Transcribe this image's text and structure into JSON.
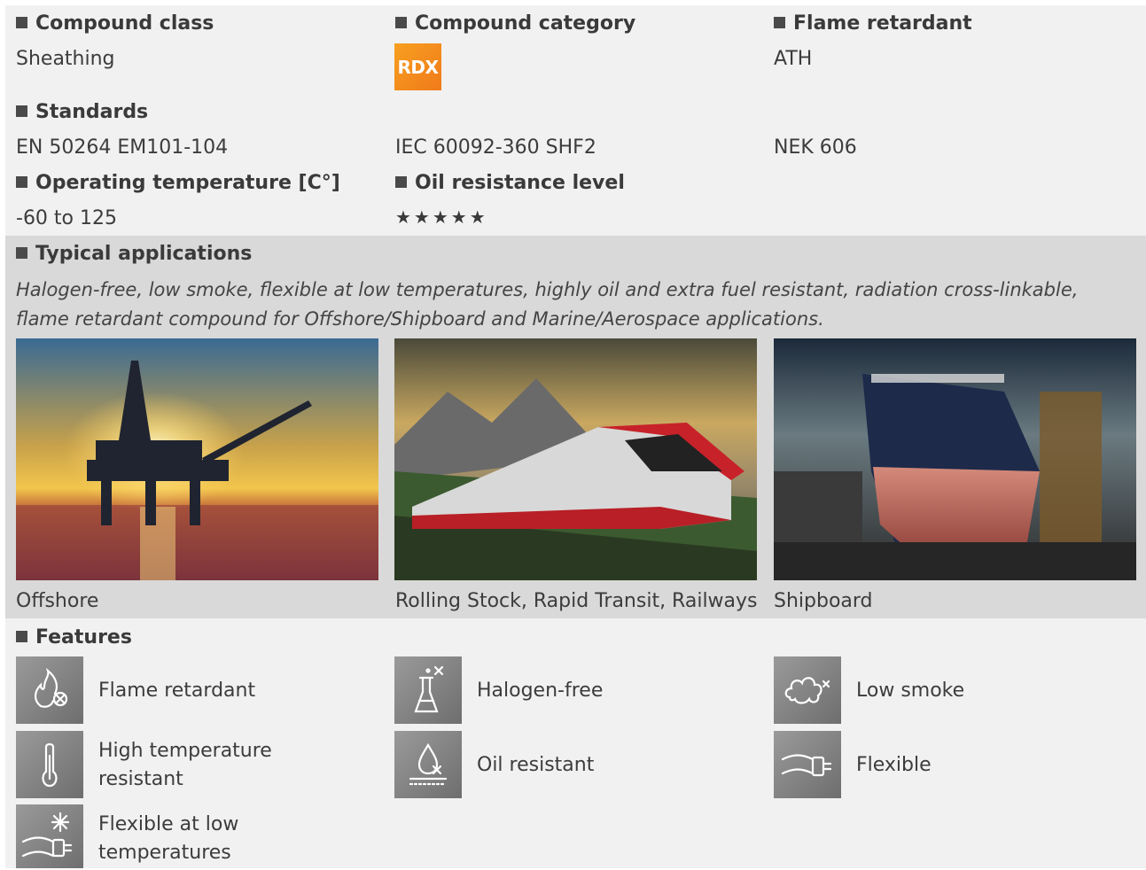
{
  "properties": {
    "compound_class": {
      "label": "Compound class",
      "value": "Sheathing"
    },
    "compound_category": {
      "label": "Compound category",
      "badge": "RDX",
      "badge_color": "#f39020"
    },
    "flame_retardant": {
      "label": "Flame retardant",
      "value": "ATH"
    },
    "standards": {
      "label": "Standards",
      "values": [
        "EN 50264 EM101-104",
        "IEC 60092-360 SHF2",
        "NEK 606"
      ]
    },
    "operating_temperature": {
      "label": "Operating temperature [C°]",
      "value": "-60 to 125"
    },
    "oil_resistance": {
      "label": "Oil resistance level",
      "stars": "★★★★★",
      "rating": 5
    }
  },
  "applications": {
    "label": "Typical applications",
    "description": "Halogen-free, low smoke, flexible at low temperatures, highly oil and extra fuel resistant, radiation cross-linkable, flame retardant compound for Offshore/Shipboard and Marine/Aerospace applications.",
    "items": [
      {
        "caption": "Offshore"
      },
      {
        "caption": "Rolling Stock, Rapid Transit, Railways"
      },
      {
        "caption": "Shipboard"
      }
    ]
  },
  "features": {
    "label": "Features",
    "items": [
      {
        "label": "Flame retardant",
        "icon": "flame-retardant-icon"
      },
      {
        "label": "Halogen-free",
        "icon": "halogen-free-icon"
      },
      {
        "label": "Low smoke",
        "icon": "low-smoke-icon"
      },
      {
        "label": "High temperature resistant",
        "icon": "thermometer-icon"
      },
      {
        "label": "Oil resistant",
        "icon": "oil-drop-icon"
      },
      {
        "label": "Flexible",
        "icon": "flexible-cable-icon"
      },
      {
        "label": "Flexible at low temperatures",
        "icon": "snowflake-cable-icon"
      }
    ]
  },
  "colors": {
    "band": "#d9d9d9",
    "background": "#f1f1f1",
    "icon_gray": "#808080"
  }
}
